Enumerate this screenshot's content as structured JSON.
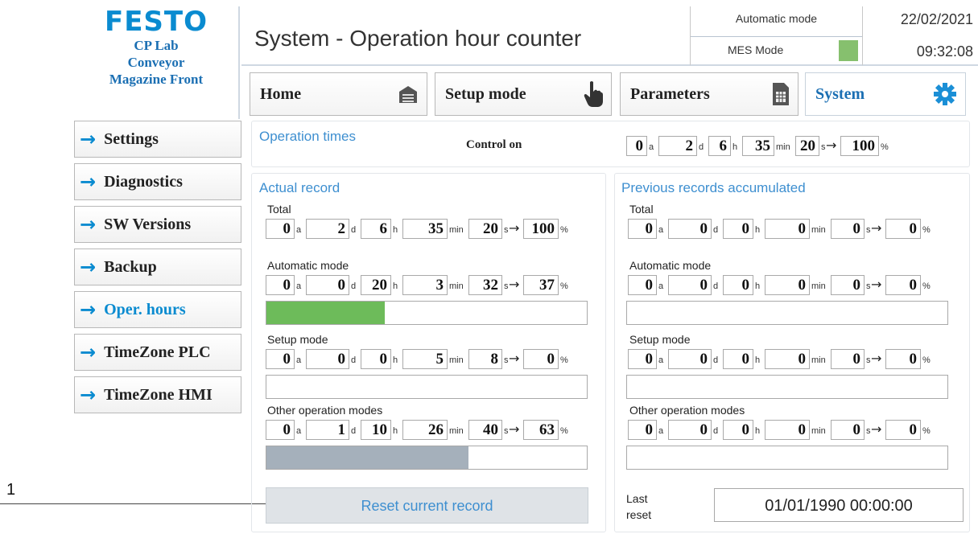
{
  "brand": {
    "logo": "FESTO",
    "line1": "CP Lab",
    "line2": "Conveyor",
    "line3": "Magazine Front"
  },
  "header": {
    "title": "System - Operation hour counter",
    "mode": "Automatic mode",
    "mes_label": "MES Mode",
    "mes_color": "#86c06e",
    "date": "22/02/2021",
    "time": "09:32:08"
  },
  "nav": [
    {
      "label": "Home",
      "icon": "factory-icon"
    },
    {
      "label": "Setup mode",
      "icon": "hand-pointer-icon"
    },
    {
      "label": "Parameters",
      "icon": "document-grid-icon"
    },
    {
      "label": "System",
      "icon": "gear-icon"
    }
  ],
  "sidebar": [
    {
      "label": "Settings"
    },
    {
      "label": "Diagnostics"
    },
    {
      "label": "SW Versions"
    },
    {
      "label": "Backup"
    },
    {
      "label": "Oper. hours"
    },
    {
      "label": "TimeZone PLC"
    },
    {
      "label": "TimeZone HMI"
    }
  ],
  "units": {
    "a": "a",
    "d": "d",
    "h": "h",
    "min": "min",
    "s": "s",
    "pct": "%",
    "arrow": "→"
  },
  "operation_times": {
    "title": "Operation times",
    "control_label": "Control on",
    "a": "0",
    "d": "2",
    "h": "6",
    "min": "35",
    "s": "20",
    "pct": "100"
  },
  "actual": {
    "title": "Actual record",
    "rows": [
      {
        "label": "Total",
        "a": "0",
        "d": "2",
        "h": "6",
        "min": "35",
        "s": "20",
        "pct": "100",
        "bar": null
      },
      {
        "label": "Automatic mode",
        "a": "0",
        "d": "0",
        "h": "20",
        "min": "3",
        "s": "32",
        "pct": "37",
        "bar": 0.37,
        "bar_color": "#6dbb5a"
      },
      {
        "label": "Setup mode",
        "a": "0",
        "d": "0",
        "h": "0",
        "min": "5",
        "s": "8",
        "pct": "0",
        "bar": 0,
        "bar_color": "#6dbb5a"
      },
      {
        "label": "Other operation modes",
        "a": "0",
        "d": "1",
        "h": "10",
        "min": "26",
        "s": "40",
        "pct": "63",
        "bar": 0.63,
        "bar_color": "#a5b0bb"
      }
    ]
  },
  "previous": {
    "title": "Previous records accumulated",
    "rows": [
      {
        "label": "Total",
        "a": "0",
        "d": "0",
        "h": "0",
        "min": "0",
        "s": "0",
        "pct": "0",
        "bar": null
      },
      {
        "label": "Automatic mode",
        "a": "0",
        "d": "0",
        "h": "0",
        "min": "0",
        "s": "0",
        "pct": "0",
        "bar": 0
      },
      {
        "label": "Setup mode",
        "a": "0",
        "d": "0",
        "h": "0",
        "min": "0",
        "s": "0",
        "pct": "0",
        "bar": 0
      },
      {
        "label": "Other operation modes",
        "a": "0",
        "d": "0",
        "h": "0",
        "min": "0",
        "s": "0",
        "pct": "0",
        "bar": 0
      }
    ]
  },
  "reset_button": "Reset current record",
  "last_reset": {
    "label_line1": "Last",
    "label_line2": "reset",
    "value": "01/01/1990 00:00:00"
  },
  "callout": "1"
}
